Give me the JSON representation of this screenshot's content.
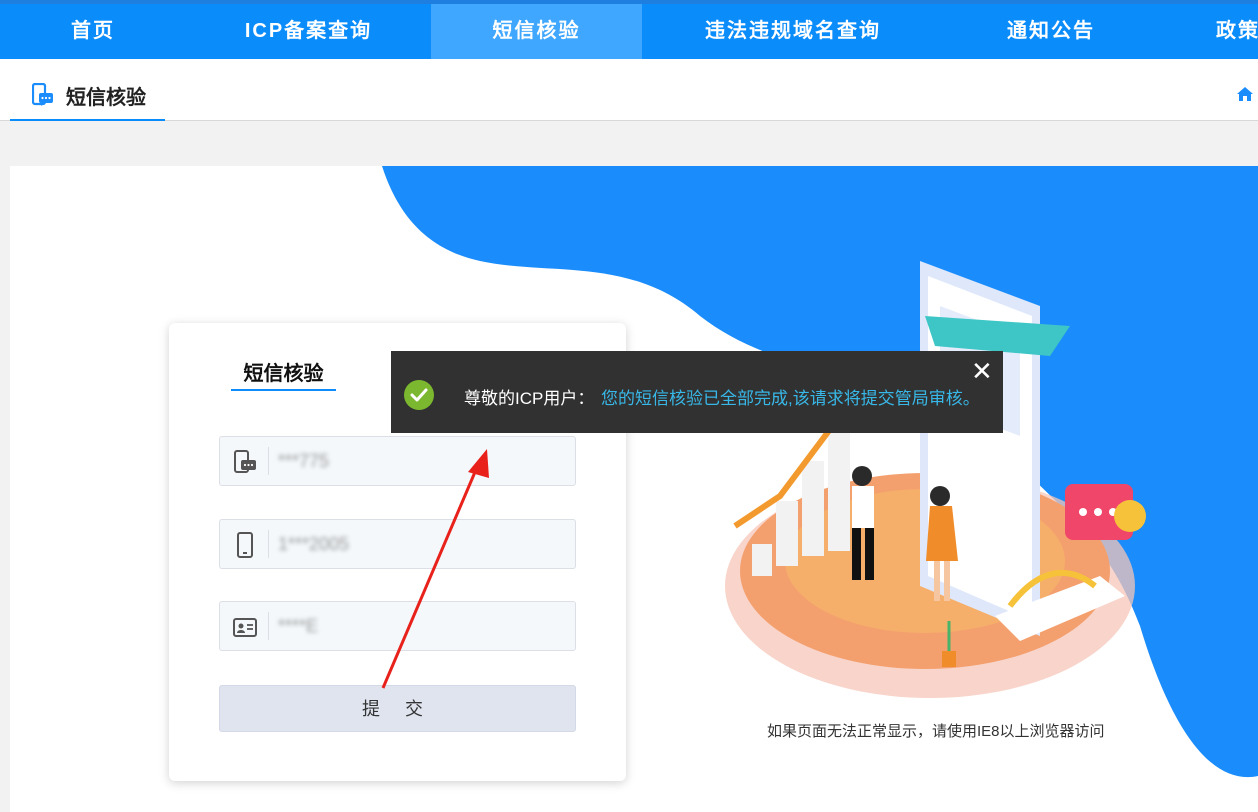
{
  "nav": {
    "items": [
      {
        "label": "首页"
      },
      {
        "label": "ICP备案查询"
      },
      {
        "label": "短信核验"
      },
      {
        "label": "违法违规域名查询"
      },
      {
        "label": "通知公告"
      },
      {
        "label": "政策"
      }
    ],
    "active_index": 2
  },
  "subnav": {
    "tab_label": "短信核验"
  },
  "form": {
    "title": "短信核验",
    "fields": [
      {
        "icon": "sms-icon",
        "value": "***775"
      },
      {
        "icon": "phone-icon",
        "value": "1***2005"
      },
      {
        "icon": "id-card-icon",
        "value": "****E"
      }
    ],
    "submit_label": "提 交"
  },
  "toast": {
    "greeting": "尊敬的ICP用户：",
    "message": "您的短信核验已全部完成,该请求将提交管局审核。",
    "close_symbol": "✕"
  },
  "footnote": "如果页面无法正常显示，请使用IE8以上浏览器访问",
  "colors": {
    "nav_bg": "#0a8cfa",
    "nav_active": "#3fa7ff",
    "accent_blue": "#1a8cfb",
    "toast_bg": "#313131",
    "toast_message": "#38b8e8",
    "success_green": "#7cb82f"
  }
}
